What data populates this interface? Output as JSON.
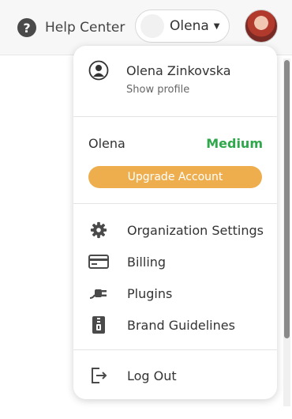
{
  "header": {
    "help_label": "Help Center",
    "account_label": "Olena",
    "help_icon": "?"
  },
  "profile": {
    "name": "Olena Zinkovska",
    "subtitle": "Show profile"
  },
  "plan": {
    "user": "Olena",
    "name": "Medium",
    "upgrade_label": "Upgrade Account"
  },
  "menu": {
    "items": [
      {
        "label": "Organization Settings",
        "icon": "gear-icon"
      },
      {
        "label": "Billing",
        "icon": "credit-card-icon"
      },
      {
        "label": "Plugins",
        "icon": "plug-icon"
      },
      {
        "label": "Brand Guidelines",
        "icon": "guidelines-icon"
      }
    ],
    "logout_label": "Log Out"
  },
  "colors": {
    "plan_green": "#2ea84a",
    "upgrade_orange": "#eeae4d",
    "icon_dark": "#4a4a4a"
  }
}
